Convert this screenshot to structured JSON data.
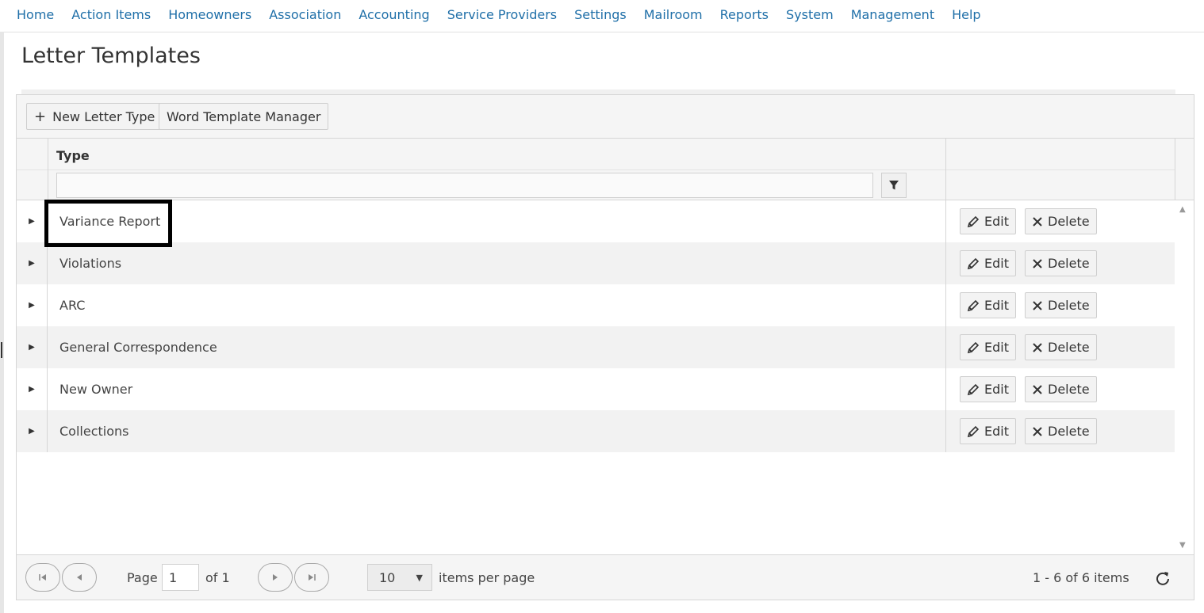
{
  "nav": {
    "items": [
      "Home",
      "Action Items",
      "Homeowners",
      "Association",
      "Accounting",
      "Service Providers",
      "Settings",
      "Mailroom",
      "Reports",
      "System",
      "Management",
      "Help"
    ]
  },
  "page": {
    "title": "Letter Templates"
  },
  "toolbar": {
    "new_letter_type": "New Letter Type",
    "word_template_manager": "Word Template Manager"
  },
  "grid": {
    "columns": {
      "type": "Type"
    },
    "filter_value": "",
    "rows": [
      {
        "type": "Variance Report",
        "edit": "Edit",
        "delete": "Delete"
      },
      {
        "type": "Violations",
        "edit": "Edit",
        "delete": "Delete"
      },
      {
        "type": "ARC",
        "edit": "Edit",
        "delete": "Delete"
      },
      {
        "type": "General Correspondence",
        "edit": "Edit",
        "delete": "Delete"
      },
      {
        "type": "New Owner",
        "edit": "Edit",
        "delete": "Delete"
      },
      {
        "type": "Collections",
        "edit": "Edit",
        "delete": "Delete"
      }
    ]
  },
  "pager": {
    "page_label": "Page",
    "page_value": "1",
    "of_label": "of 1",
    "page_size": "10",
    "items_per_page": "items per page",
    "summary": "1 - 6 of 6 items"
  },
  "colors": {
    "nav_link": "#1f6fa8",
    "highlight": "#000000"
  }
}
